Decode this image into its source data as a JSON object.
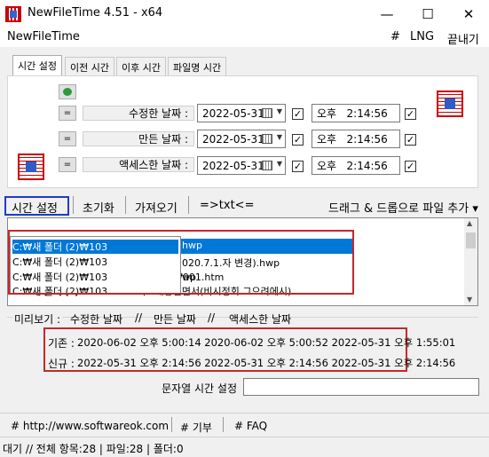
{
  "window": {
    "title": "NewFileTime 4.51 - x64",
    "minimize": "—",
    "maximize": "☐",
    "close": "✕"
  },
  "menu": {
    "app_name": "NewFileTime",
    "hash": "#",
    "lng": "LNG",
    "exit": "끝내기"
  },
  "tabs": [
    "시간 설정",
    "이전 시간",
    "이후 시간",
    "파일명 시간"
  ],
  "rows": [
    {
      "btn": "=",
      "label": "수정한 날짜 :",
      "date": "2022-05-31",
      "ampm": "오후",
      "time": "2:14:56",
      "date_checked": true,
      "time_checked": true
    },
    {
      "btn": "=",
      "label": "만든 날짜 :",
      "date": "2022-05-31",
      "ampm": "오후",
      "time": "2:14:56",
      "date_checked": true,
      "time_checked": true
    },
    {
      "btn": "=",
      "label": "액세스한 날짜 :",
      "date": "2022-05-31",
      "ampm": "오후",
      "time": "2:14:56",
      "date_checked": true,
      "time_checked": true
    }
  ],
  "toolbar": {
    "set_time": "시간 설정",
    "reset": "초기화",
    "import": "가져오기",
    "to_txt": "=>txt<=",
    "drag_drop": "드래그 & 드롭으로 파일 추가 ▾"
  },
  "file_list": {
    "popup_rows": [
      "C:₩새 폴더 (2)₩103",
      "C:₩새 폴더 (2)₩103",
      "C:₩새 폴더 (2)₩103",
      "C:₩새 폴더 (2)₩103"
    ],
    "background_rows": [
      "hwp",
      "020.7.1.자 변경).hwp",
      "wp",
      "C:₩새 폴더 (2)₩103 / 중보도 수정본₩001.htm",
      "C:₩새 폴더 (2)₩104 5 그으지도재충연면서(비시정회 그으려에시)"
    ]
  },
  "preview": {
    "legend": [
      "미리보기 :",
      "수정한 날짜",
      "//",
      "만든 날짜",
      "//",
      "액세스한 날짜"
    ],
    "original_label": "기존 :",
    "original_values": "2020-06-02 오후 5:00:14 2020-06-02 오후 5:00:52 2022-05-31 오후 1:55:01",
    "new_label": "신규 :",
    "new_values": "2022-05-31 오후 2:14:56 2022-05-31 오후 2:14:56 2022-05-31 오후 2:14:56"
  },
  "string_time": {
    "label": "문자열 시간 설정",
    "value": ""
  },
  "footer": {
    "website": "# http://www.softwareok.com",
    "donate": "# 기부",
    "faq": "# FAQ"
  },
  "status": "대기 // 전체 항목:28 | 파일:28 | 폴더:0",
  "colors": {
    "accent_blue": "#0078d7",
    "highlight_red": "#c62828",
    "frame_blue": "#1f3cc4"
  }
}
